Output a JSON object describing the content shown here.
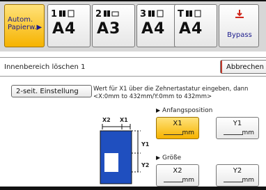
{
  "trays": {
    "auto": {
      "label": "Autom. Papierw.▶"
    },
    "items": [
      {
        "num": "1",
        "size": "A4"
      },
      {
        "num": "2",
        "size": "A3"
      },
      {
        "num": "3",
        "size": "A4"
      },
      {
        "num": "T",
        "size": "A4"
      }
    ],
    "bypass": {
      "label": "Bypass"
    }
  },
  "header": {
    "title": "Innenbereich löschen 1",
    "cancel_label": "Abbrechen"
  },
  "duplex_label": "2-seit. Einstellung",
  "instructions": {
    "line1": "Wert für X1 über die Zehnertastatur eingeben, dann",
    "line2": "<X:0mm to 432mm/Y:0mm to 432mm>"
  },
  "diagram": {
    "label_x2": "X2",
    "label_x1": "X1",
    "label_y1": "Y1",
    "label_y2": "Y2"
  },
  "position": {
    "label": "Anfangsposition",
    "fields": [
      {
        "name": "X1",
        "unit": "mm",
        "active": true
      },
      {
        "name": "Y1",
        "unit": "mm",
        "active": false
      }
    ]
  },
  "size": {
    "label": "Größe",
    "fields": [
      {
        "name": "X2",
        "unit": "mm"
      },
      {
        "name": "Y2",
        "unit": "mm"
      }
    ]
  },
  "colors": {
    "accent": "#f6b300",
    "label_blue": "#1a1a8c",
    "doc_blue": "#1f4fbf"
  }
}
